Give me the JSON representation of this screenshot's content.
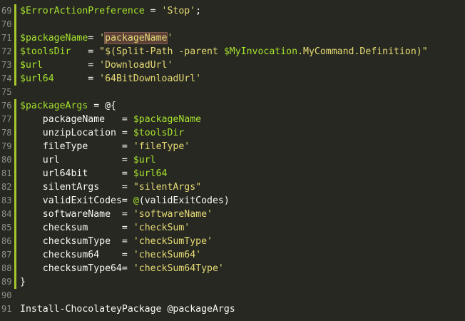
{
  "editor": {
    "lines": [
      {
        "num": "69",
        "segments": [
          {
            "t": "$ErrorActionPreference",
            "c": "var"
          },
          {
            "t": " = ",
            "c": "op"
          },
          {
            "t": "'Stop'",
            "c": "str"
          },
          {
            "t": ";",
            "c": "op"
          }
        ],
        "bar": true
      },
      {
        "num": "70",
        "segments": [],
        "bar": true
      },
      {
        "num": "71",
        "segments": [
          {
            "t": "$packageName",
            "c": "var"
          },
          {
            "t": "= ",
            "c": "op"
          },
          {
            "t": "'",
            "c": "str"
          },
          {
            "t": "packageName",
            "c": "str hl"
          },
          {
            "t": "'",
            "c": "str"
          }
        ],
        "bar": true
      },
      {
        "num": "72",
        "segments": [
          {
            "t": "$toolsDir",
            "c": "var"
          },
          {
            "t": "   = ",
            "c": "op"
          },
          {
            "t": "\"$(Split-Path -parent ",
            "c": "str"
          },
          {
            "t": "$MyInvocation",
            "c": "var"
          },
          {
            "t": ".MyCommand.Definition)\"",
            "c": "str"
          }
        ],
        "bar": true
      },
      {
        "num": "73",
        "segments": [
          {
            "t": "$url",
            "c": "var"
          },
          {
            "t": "        = ",
            "c": "op"
          },
          {
            "t": "'DownloadUrl'",
            "c": "str"
          }
        ],
        "bar": true
      },
      {
        "num": "74",
        "segments": [
          {
            "t": "$url64",
            "c": "var"
          },
          {
            "t": "      = ",
            "c": "op"
          },
          {
            "t": "'64BitDownloadUrl'",
            "c": "str"
          }
        ],
        "bar": true
      },
      {
        "num": "75",
        "segments": [],
        "bar": false
      },
      {
        "num": "76",
        "segments": [
          {
            "t": "$packageArgs",
            "c": "var"
          },
          {
            "t": " = ",
            "c": "op"
          },
          {
            "t": "@{",
            "c": "op"
          }
        ],
        "bar": true
      },
      {
        "num": "77",
        "segments": [
          {
            "t": "    packageName   ",
            "c": "op"
          },
          {
            "t": "= ",
            "c": "op"
          },
          {
            "t": "$packageName",
            "c": "var"
          }
        ],
        "bar": true
      },
      {
        "num": "78",
        "segments": [
          {
            "t": "    unzipLocation ",
            "c": "op"
          },
          {
            "t": "= ",
            "c": "op"
          },
          {
            "t": "$toolsDir",
            "c": "var"
          }
        ],
        "bar": true
      },
      {
        "num": "79",
        "segments": [
          {
            "t": "    fileType      ",
            "c": "op"
          },
          {
            "t": "= ",
            "c": "op"
          },
          {
            "t": "'fileType'",
            "c": "str"
          }
        ],
        "bar": true
      },
      {
        "num": "80",
        "segments": [
          {
            "t": "    url           ",
            "c": "op"
          },
          {
            "t": "= ",
            "c": "op"
          },
          {
            "t": "$url",
            "c": "var"
          }
        ],
        "bar": true
      },
      {
        "num": "81",
        "segments": [
          {
            "t": "    url64bit      ",
            "c": "op"
          },
          {
            "t": "= ",
            "c": "op"
          },
          {
            "t": "$url64",
            "c": "var"
          }
        ],
        "bar": true
      },
      {
        "num": "82",
        "segments": [
          {
            "t": "    silentArgs    ",
            "c": "op"
          },
          {
            "t": "= ",
            "c": "op"
          },
          {
            "t": "\"silentArgs\"",
            "c": "str"
          }
        ],
        "bar": true
      },
      {
        "num": "83",
        "segments": [
          {
            "t": "    validExitCodes",
            "c": "op"
          },
          {
            "t": "= ",
            "c": "op"
          },
          {
            "t": "@",
            "c": "var"
          },
          {
            "t": "(validExitCodes)",
            "c": "op"
          }
        ],
        "bar": true
      },
      {
        "num": "84",
        "segments": [
          {
            "t": "    softwareName  ",
            "c": "op"
          },
          {
            "t": "= ",
            "c": "op"
          },
          {
            "t": "'softwareName'",
            "c": "str"
          }
        ],
        "bar": true
      },
      {
        "num": "85",
        "segments": [
          {
            "t": "    checksum      ",
            "c": "op"
          },
          {
            "t": "= ",
            "c": "op"
          },
          {
            "t": "'checkSum'",
            "c": "str"
          }
        ],
        "bar": true
      },
      {
        "num": "86",
        "segments": [
          {
            "t": "    checksumType  ",
            "c": "op"
          },
          {
            "t": "= ",
            "c": "op"
          },
          {
            "t": "'checkSumType'",
            "c": "str"
          }
        ],
        "bar": true
      },
      {
        "num": "87",
        "segments": [
          {
            "t": "    checksum64    ",
            "c": "op"
          },
          {
            "t": "= ",
            "c": "op"
          },
          {
            "t": "'checkSum64'",
            "c": "str"
          }
        ],
        "bar": true
      },
      {
        "num": "88",
        "segments": [
          {
            "t": "    checksumType64",
            "c": "op"
          },
          {
            "t": "= ",
            "c": "op"
          },
          {
            "t": "'checkSum64Type'",
            "c": "str"
          }
        ],
        "bar": true
      },
      {
        "num": "89",
        "segments": [
          {
            "t": "}",
            "c": "op"
          }
        ],
        "bar": true
      },
      {
        "num": "90",
        "segments": [],
        "bar": false
      },
      {
        "num": "91",
        "segments": [
          {
            "t": "Install-ChocolateyPackage ",
            "c": "op"
          },
          {
            "t": "@packageArgs",
            "c": "op"
          }
        ],
        "bar": false
      }
    ]
  },
  "colors": {
    "background": "#272822",
    "variable": "#a6e22e",
    "string": "#e6db74",
    "text": "#f8f8f2",
    "line_number": "#8f908a",
    "modified_bar": "#a6c82a",
    "selection_highlight": "#5c4038"
  }
}
